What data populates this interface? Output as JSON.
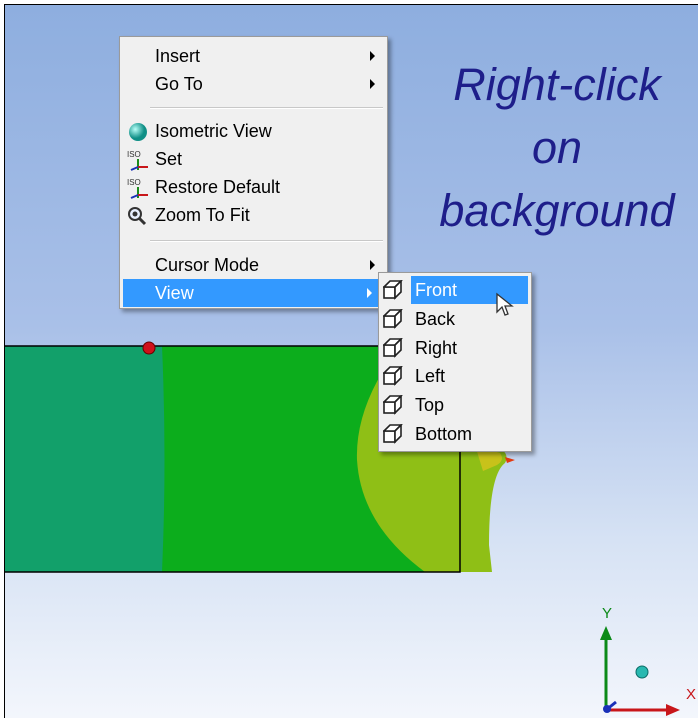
{
  "caption": {
    "line1": "Right-click",
    "line2": "on",
    "line3": "background"
  },
  "context_menu": {
    "insert": "Insert",
    "go_to": "Go To",
    "isometric_view": "Isometric View",
    "set": "Set",
    "restore_default": "Restore Default",
    "zoom_to_fit": "Zoom To Fit",
    "cursor_mode": "Cursor Mode",
    "view": "View"
  },
  "view_submenu": {
    "items": [
      "Front",
      "Back",
      "Right",
      "Left",
      "Top",
      "Bottom"
    ],
    "highlighted": "Front"
  },
  "triad": {
    "x_label": "X",
    "y_label": "Y"
  },
  "colors": {
    "background_top": "#8eaedf",
    "background_bottom": "#f3f6fc",
    "menu_highlight": "#3399ff",
    "model_teal": "#12a06a",
    "model_green": "#0cad1c",
    "model_yellow_green": "#8fbf16",
    "caption": "#1e1e8a"
  }
}
